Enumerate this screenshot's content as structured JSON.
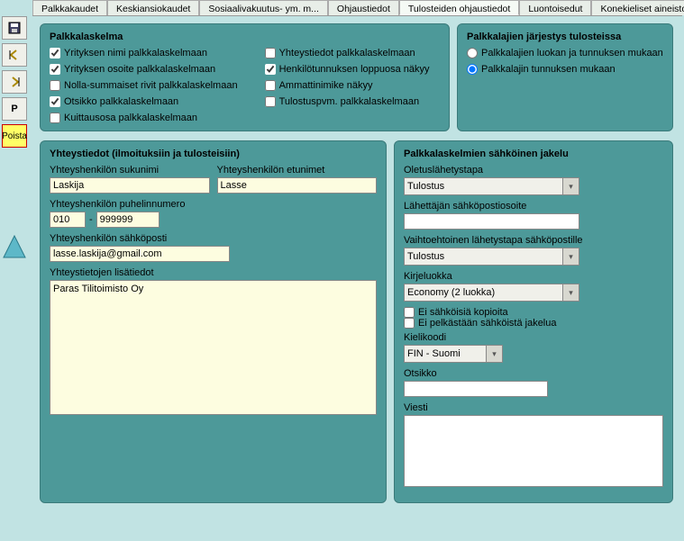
{
  "tabs": {
    "t0": "Palkkakaudet",
    "t1": "Keskiansiokaudet",
    "t2": "Sosiaalivakuutus- ym. m...",
    "t3": "Ohjaustiedot",
    "t4": "Tulosteiden ohjaustiedot",
    "t5": "Luontoisedut",
    "t6": "Konekieliset aineistot"
  },
  "toolbar": {
    "p_label": "P",
    "poista_label": "Poista"
  },
  "palkkalaskelma": {
    "title": "Palkkalaskelma",
    "c0": "Yrityksen nimi palkkalaskelmaan",
    "c1": "Yrityksen osoite palkkalaskelmaan",
    "c2": "Nolla-summaiset rivit palkkalaskelmaan",
    "c3": "Otsikko palkkalaskelmaan",
    "c4": "Kuittausosa palkkalaskelmaan",
    "c5": "Yhteystiedot palkkalaskelmaan",
    "c6": "Henkilötunnuksen loppuosa näkyy",
    "c7": "Ammattinimike näkyy",
    "c8": "Tulostuspvm. palkkalaskelmaan"
  },
  "jarjestys": {
    "title": "Palkkalajien järjestys tulosteissa",
    "r0": "Palkkalajien luokan ja tunnuksen mukaan",
    "r1": "Palkkalajin tunnuksen mukaan"
  },
  "yhteys": {
    "title": "Yhteystiedot (ilmoituksiin ja tulosteisiin)",
    "sukunimi_lbl": "Yhteyshenkilön sukunimi",
    "sukunimi_val": "Laskija",
    "etunimet_lbl": "Yhteyshenkilön etunimet",
    "etunimet_val": "Lasse",
    "puh_lbl": "Yhteyshenkilön puhelinnumero",
    "puh_a": "010",
    "puh_b": "999999",
    "email_lbl": "Yhteyshenkilön sähköposti",
    "email_val": "lasse.laskija@gmail.com",
    "lisa_lbl": "Yhteystietojen lisätiedot",
    "lisa_val": "Paras Tilitoimisto Oy"
  },
  "jakelu": {
    "title": "Palkkalaskelmien sähköinen jakelu",
    "oletus_lbl": "Oletuslähetystapa",
    "oletus_val": "Tulostus",
    "lahettaja_lbl": "Lähettäjän sähköpostiosoite",
    "vaihto_lbl": "Vaihtoehtoinen lähetystapa sähköpostille",
    "vaihto_val": "Tulostus",
    "kirje_lbl": "Kirjeluokka",
    "kirje_val": "Economy (2 luokka)",
    "chk0": "Ei sähköisiä kopioita",
    "chk1": "Ei pelkästään sähköistä jakelua",
    "kieli_lbl": "Kielikoodi",
    "kieli_val": "FIN - Suomi",
    "otsikko_lbl": "Otsikko",
    "viesti_lbl": "Viesti"
  }
}
